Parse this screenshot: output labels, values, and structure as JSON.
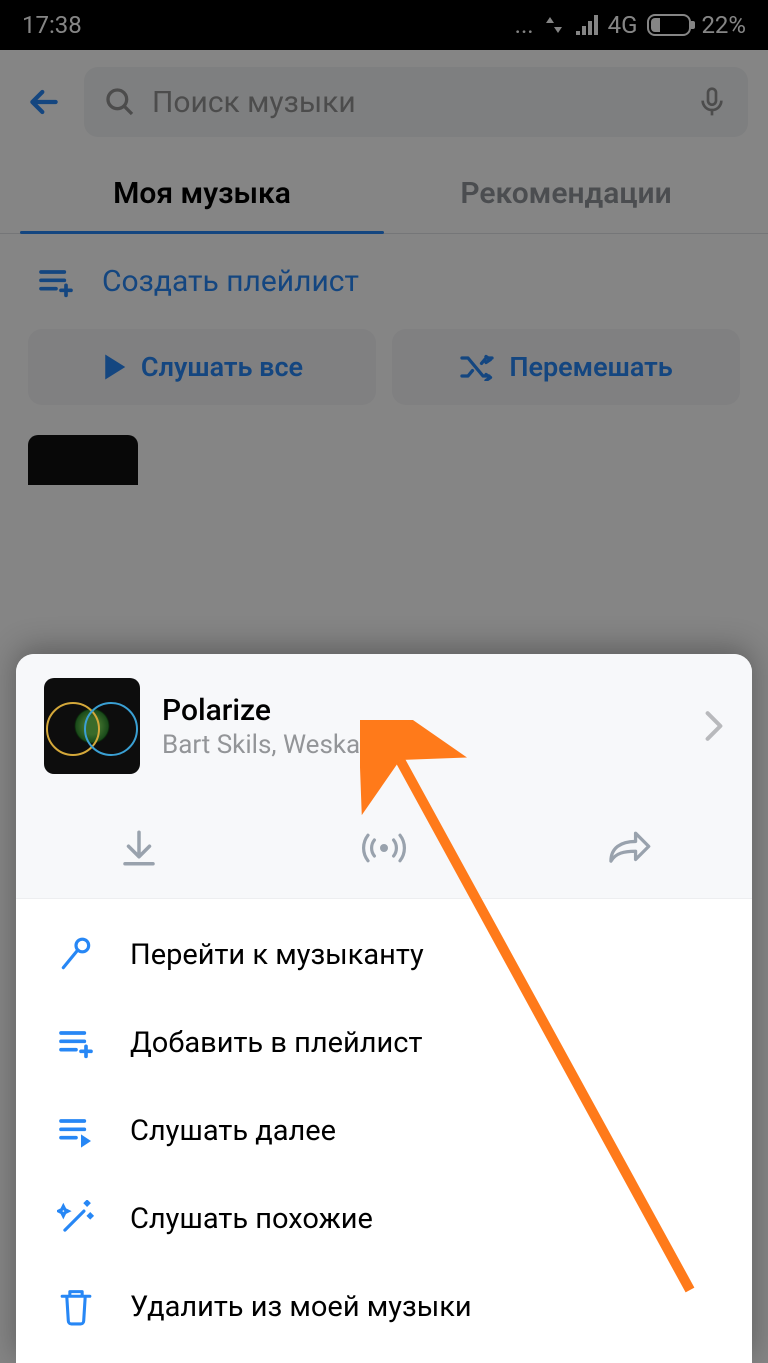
{
  "status": {
    "time": "17:38",
    "network": "4G",
    "battery": "22%"
  },
  "search": {
    "placeholder": "Поиск музыки"
  },
  "tabs": {
    "my_music": "Моя музыка",
    "recommendations": "Рекомендации"
  },
  "create_playlist": "Создать плейлист",
  "actions": {
    "play_all": "Слушать все",
    "shuffle": "Перемешать"
  },
  "sheet": {
    "track": {
      "title": "Polarize",
      "artist": "Bart Skils, Weska"
    },
    "menu": {
      "go_to_artist": "Перейти к музыканту",
      "add_to_playlist": "Добавить в плейлист",
      "play_next": "Слушать далее",
      "play_similar": "Слушать похожие",
      "delete_from_my_music": "Удалить из моей музыки"
    }
  }
}
